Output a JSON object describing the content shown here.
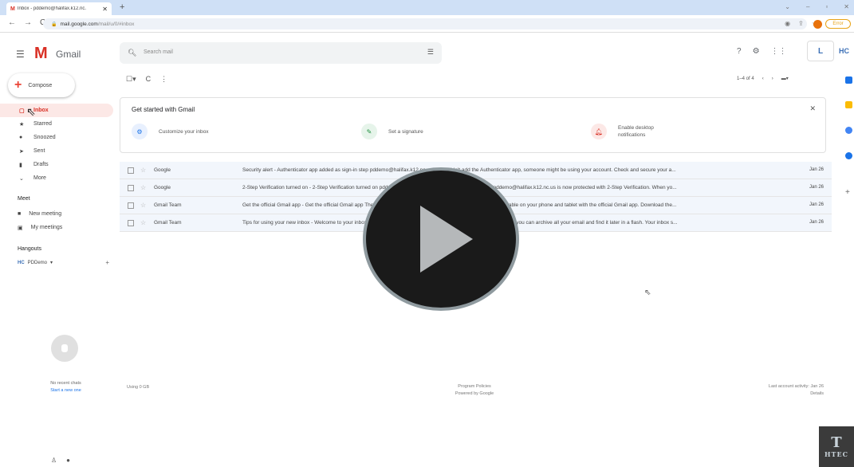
{
  "browser": {
    "tab_title": "Inbox - pddemo@halifax.k12.nc.",
    "tab_icon": "M",
    "url_domain": "mail.google.com",
    "url_path": "/mail/u/0/#inbox",
    "error_label": "Error"
  },
  "gmail": {
    "logo_text": "Gmail",
    "search_placeholder": "Search mail",
    "compose_label": "Compose",
    "nav": [
      {
        "label": "Inbox",
        "icon": "inbox-icon"
      },
      {
        "label": "Starred",
        "icon": "star-icon"
      },
      {
        "label": "Snoozed",
        "icon": "clock-icon"
      },
      {
        "label": "Sent",
        "icon": "send-icon"
      },
      {
        "label": "Drafts",
        "icon": "draft-icon"
      },
      {
        "label": "More",
        "icon": "chevron-down-icon"
      }
    ],
    "meet": {
      "heading": "Meet",
      "new_meeting": "New meeting",
      "my_meetings": "My meetings"
    },
    "hangouts": {
      "heading": "Hangouts",
      "user": "PDDemo",
      "no_chats": "No recent chats",
      "start_chat": "Start a new one"
    },
    "pager": "1–4 of 4",
    "getting_started": {
      "title": "Get started with Gmail",
      "items": [
        {
          "label": "Customize your inbox",
          "color": "#1a73e8"
        },
        {
          "label": "Set a signature",
          "color": "#1e8e3e"
        },
        {
          "label": "Enable desktop notifications",
          "color": "#d93025"
        }
      ]
    },
    "emails": [
      {
        "sender": "Google",
        "snippet": "Security alert - Authenticator app added as sign-in step pddemo@halifax.k12.nc.us If you didn't add the Authenticator app, someone might be using your account. Check and secure your a...",
        "date": "Jan 26"
      },
      {
        "sender": "Google",
        "snippet": "2-Step Verification turned on - 2-Step Verification turned on pddemo@halifax.k12.nc.us Your Google Account pddemo@halifax.k12.nc.us is now protected with 2-Step Verification. When yo...",
        "date": "Jan 26"
      },
      {
        "sender": "Gmail Team",
        "snippet": "Get the official Gmail app - Get the official Gmail app The best features of Halifax County Schools Mail are only available on your phone and tablet with the official Gmail app. Download the...",
        "date": "Jan 26"
      },
      {
        "sender": "Gmail Team",
        "snippet": "Tips for using your new inbox - Welcome to your inbox Find emails fast With the power of Google Search in your inbox, you can archive all your email and find it later in a flash. Your inbox s...",
        "date": "Jan 26"
      }
    ],
    "footer": {
      "storage": "Using 0 GB",
      "policies": "Program Policies",
      "powered": "Powered by Google",
      "last_activity": "Last account activity: Jan 26",
      "details": "Details"
    }
  },
  "watermark": {
    "letter": "T",
    "text": "HTEC"
  }
}
